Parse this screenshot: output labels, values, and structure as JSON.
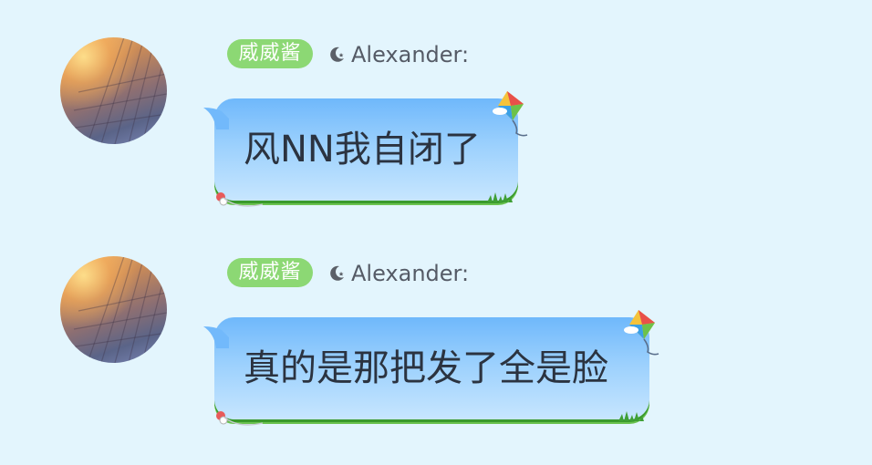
{
  "messages": [
    {
      "badge": "威威酱",
      "moon_icon": "moon-star-icon",
      "username": "Alexander:",
      "text": "风NN我自闭了"
    },
    {
      "badge": "威威酱",
      "moon_icon": "moon-star-icon",
      "username": "Alexander:",
      "text": "真的是那把发了全是脸"
    }
  ],
  "colors": {
    "background": "#e3f5fd",
    "badge": "#8cd874",
    "bubble_top": "#6fb8fb",
    "bubble_bottom": "#c7e6fe",
    "grass": "#3a9a2c",
    "username": "#555b66",
    "message_text": "#2b3340"
  }
}
